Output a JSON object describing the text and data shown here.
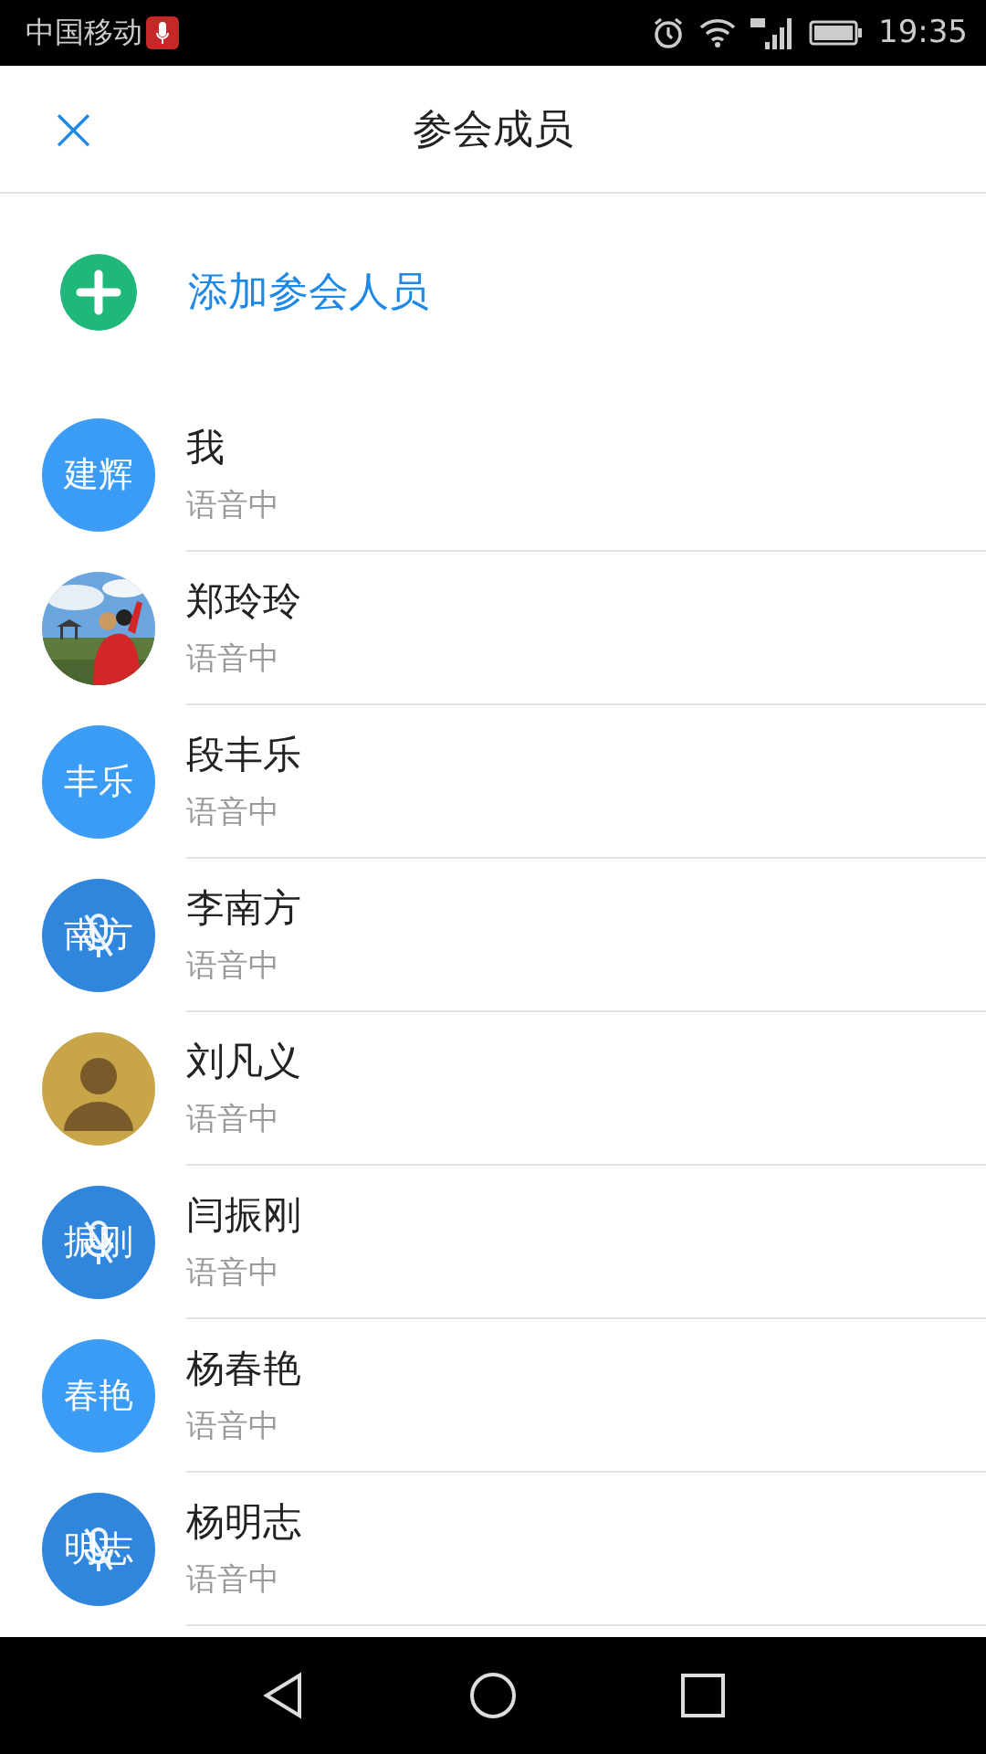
{
  "status_bar": {
    "carrier": "中国移动",
    "time": "19:35"
  },
  "header": {
    "close": "×",
    "title": "参会成员"
  },
  "add_member": {
    "label": "添加参会人员"
  },
  "members": [
    {
      "name": "我",
      "status": "语音中",
      "avatar": {
        "kind": "text",
        "label": "建辉",
        "muted": false
      }
    },
    {
      "name": "郑玲玲",
      "status": "语音中"
    },
    {
      "name": "段丰乐",
      "status": "语音中",
      "avatar": {
        "kind": "text",
        "label": "丰乐",
        "muted": false
      }
    },
    {
      "name": "李南方",
      "status": "语音中",
      "avatar": {
        "kind": "text",
        "label": "南方",
        "muted": true
      }
    },
    {
      "name": "刘凡义",
      "status": "语音中",
      "avatar": {
        "kind": "silhouette"
      }
    },
    {
      "name": "闫振刚",
      "status": "语音中",
      "avatar": {
        "kind": "text",
        "label": "振刚",
        "muted": true
      }
    },
    {
      "name": "杨春艳",
      "status": "语音中",
      "avatar": {
        "kind": "text",
        "label": "春艳",
        "muted": false
      }
    },
    {
      "name": "杨明志",
      "status": "语音中",
      "avatar": {
        "kind": "text",
        "label": "明志",
        "muted": true
      }
    }
  ]
}
